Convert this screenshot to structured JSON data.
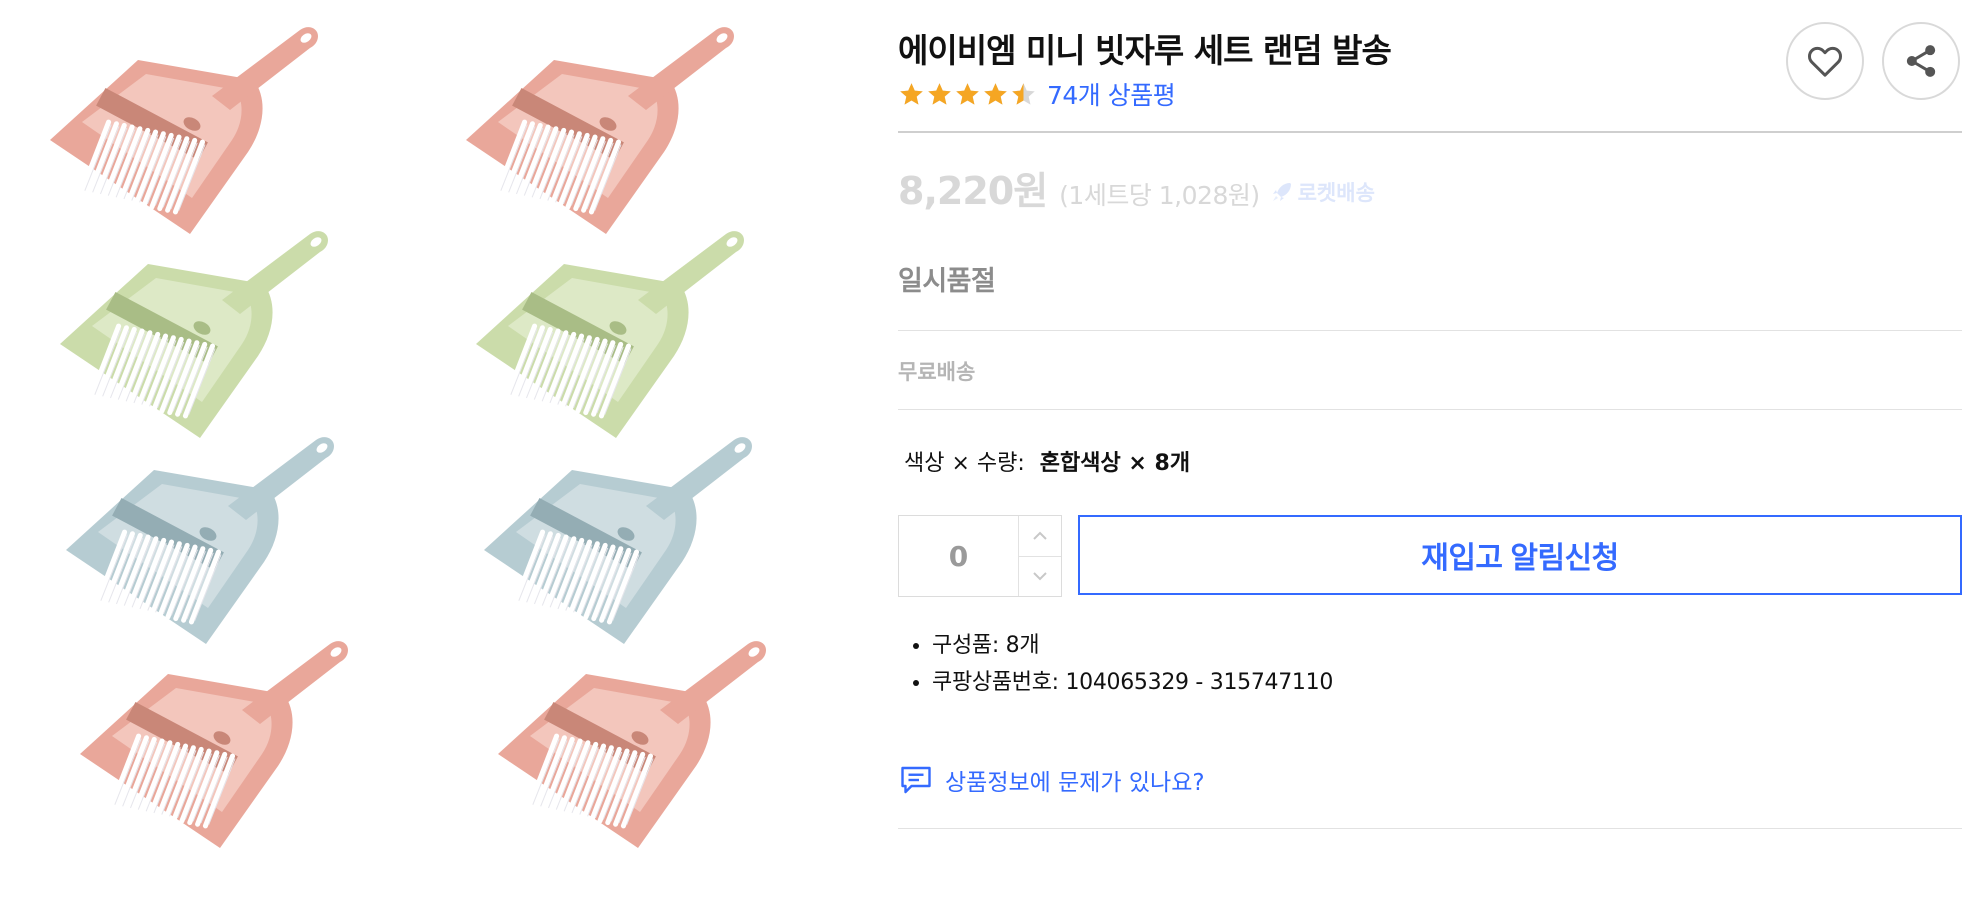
{
  "product": {
    "title": "에이비엠 미니 빗자루 세트 랜덤 발송",
    "rating_stars": 4.5,
    "review_count_text": "74개 상품평",
    "price": "8,220원",
    "unit_price": "(1세트당 1,028원)",
    "delivery_badge": "로켓배송",
    "status": "일시품절",
    "shipping": "무료배송",
    "option_label": "색상 × 수량:",
    "option_value": "혼합색상 × 8개",
    "quantity": "0",
    "restock_button": "재입고 알림신청",
    "details": [
      "구성품: 8개",
      "쿠팡상품번호: 104065329 - 315747110"
    ],
    "report_link": "상품정보에 문제가 있나요?"
  },
  "gallery": {
    "items": [
      {
        "name": "pink"
      },
      {
        "name": "pink"
      },
      {
        "name": "green"
      },
      {
        "name": "green"
      },
      {
        "name": "blue"
      },
      {
        "name": "blue"
      },
      {
        "name": "pink"
      },
      {
        "name": "pink"
      }
    ]
  },
  "icons": {
    "favorite": "heart-icon",
    "share": "share-icon",
    "star": "star-icon",
    "rocket": "rocket-icon",
    "report": "chat-icon"
  },
  "colors": {
    "accent": "#346aff",
    "star": "#f5a623",
    "pink": "#e9a79a",
    "green": "#cbdcaa",
    "blue": "#b6ccd2"
  }
}
